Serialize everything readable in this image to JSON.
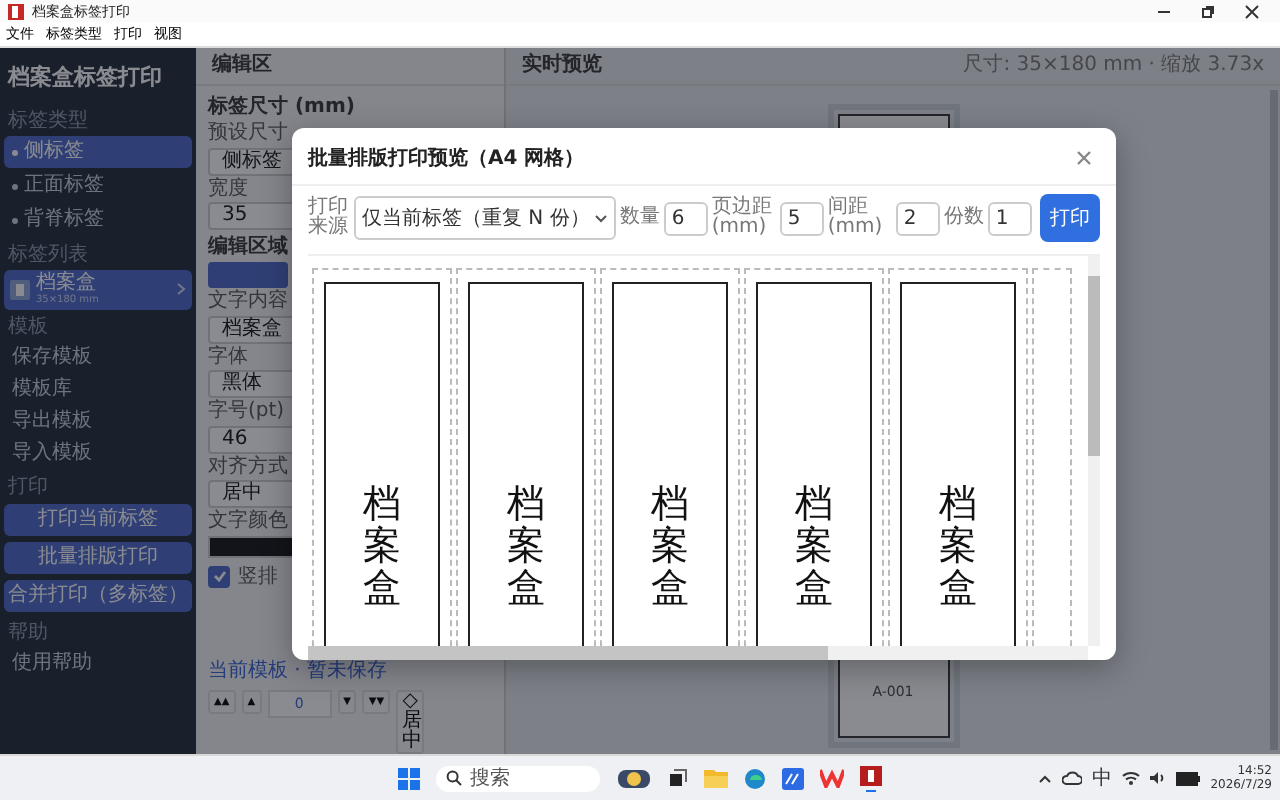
{
  "window": {
    "title": "档案盒标签打印"
  },
  "menu": [
    "文件",
    "标签类型",
    "打印",
    "视图"
  ],
  "sidebar": {
    "title": "档案盒标签打印",
    "sections": [
      {
        "heading": "标签类型",
        "items": [
          {
            "kind": "nav",
            "label": "侧标签",
            "selected": true
          },
          {
            "kind": "nav",
            "label": "正面标签",
            "selected": false
          },
          {
            "kind": "nav",
            "label": "背脊标签",
            "selected": false
          }
        ]
      },
      {
        "heading": "标签列表",
        "items": [
          {
            "kind": "label",
            "label": "档案盒",
            "detail": "35×180 mm",
            "selected": true
          }
        ]
      },
      {
        "heading": "模板",
        "items": [
          {
            "kind": "link",
            "label": "保存模板"
          },
          {
            "kind": "link",
            "label": "模板库"
          },
          {
            "kind": "link",
            "label": "导出模板"
          },
          {
            "kind": "link",
            "label": "导入模板"
          }
        ]
      },
      {
        "heading": "打印",
        "items": [
          {
            "kind": "button",
            "label": "打印当前标签"
          },
          {
            "kind": "button",
            "label": "批量排版打印"
          },
          {
            "kind": "button",
            "label": "合并打印（多标签）"
          }
        ]
      },
      {
        "heading": "帮助",
        "items": [
          {
            "kind": "link",
            "label": "使用帮助"
          }
        ]
      }
    ]
  },
  "editor": {
    "title": "编辑区",
    "rows": [
      {
        "kind": "heading",
        "label": "标签尺寸 (mm)"
      },
      {
        "kind": "field",
        "label": "预设尺寸",
        "value": "侧标签"
      },
      {
        "kind": "field",
        "label": "宽度",
        "value": "35"
      },
      {
        "kind": "heading",
        "label": "编辑区域"
      },
      {
        "kind": "button"
      },
      {
        "kind": "field",
        "label": "文字内容",
        "value": "档案盒"
      },
      {
        "kind": "field",
        "label": "字体",
        "value": "黑体"
      },
      {
        "kind": "field",
        "label": "字号(pt)",
        "value": "46"
      },
      {
        "kind": "field",
        "label": "对齐方式",
        "value": "居中"
      },
      {
        "kind": "color",
        "label": "文字颜色",
        "color": "#111111"
      },
      {
        "kind": "checkbox",
        "label": "竖排",
        "checked": true
      },
      {
        "kind": "link",
        "label": "当前模板 · 暂未保存"
      }
    ],
    "toolbar": [
      {
        "kind": "button",
        "label": "▲▲"
      },
      {
        "kind": "button",
        "label": "▲"
      },
      {
        "kind": "input",
        "value": "0"
      },
      {
        "kind": "button",
        "label": "▼"
      },
      {
        "kind": "button",
        "label": "▼▼"
      },
      {
        "kind": "stack",
        "label": "◇居中"
      }
    ]
  },
  "preview": {
    "title": "实时预览",
    "info": "尺寸: 35×180 mm · 缩放 3.73x",
    "code": "A-001"
  },
  "modal": {
    "title": "批量排版打印预览（A4 网格）",
    "source_label": "打印来源",
    "source": "仅当前标签（重复 N 份）",
    "fields": [
      {
        "label": "数量",
        "value": "6"
      },
      {
        "label": "页边距(mm)",
        "value": "5"
      },
      {
        "label": "间距(mm)",
        "value": "2"
      },
      {
        "label": "份数",
        "value": "1"
      }
    ],
    "print_button": "打印",
    "labels": [
      "档案盒",
      "档案盒",
      "档案盒",
      "档案盒",
      "档案盒"
    ]
  },
  "taskbar": {
    "search_placeholder": "搜索",
    "ime": "中",
    "time": "14:52",
    "date": "2026/7/29"
  }
}
